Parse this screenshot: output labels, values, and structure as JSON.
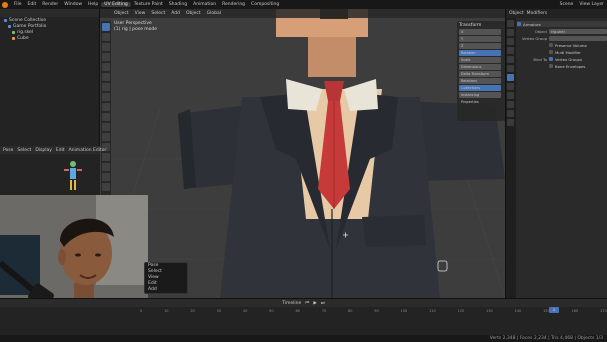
{
  "menubar": {
    "items": [
      "File",
      "Edit",
      "Render",
      "Window",
      "Help"
    ],
    "tabs": [
      "UV Editing",
      "Texture Paint",
      "Shading",
      "Animation",
      "Rendering",
      "Compositing"
    ],
    "active_tab": "UV Editing",
    "right": [
      "Scene",
      "View Layer"
    ]
  },
  "outliner": {
    "items": [
      "Scene Collection",
      "Game Portfolio",
      "rig.skel",
      "Cube"
    ]
  },
  "viewport": {
    "header": [
      "User Perspective",
      "Object",
      "View",
      "Select",
      "Add",
      "Object",
      "Global"
    ],
    "info": [
      "User Perspective",
      "(1) rig | pose mode"
    ]
  },
  "npanel": {
    "section": "Transform",
    "rows": [
      "X",
      "Y",
      "Z",
      "Rotation",
      "Scale",
      "Dimensions",
      "Delta Transform",
      "Relations",
      "Collections",
      "Instancing",
      "Properties"
    ],
    "tabs": [
      "Item",
      "Tool",
      "View"
    ]
  },
  "rig_panel": {
    "tabs": [
      "Pose",
      "Select",
      "Display",
      "Edit"
    ],
    "title": "Animation Editor"
  },
  "context_menu": {
    "items": [
      "Pose",
      "Select",
      "View",
      "Edit",
      "Add"
    ]
  },
  "properties": {
    "header": [
      "Object",
      "Modifiers"
    ],
    "title": "Armature",
    "rows": [
      {
        "label": "Object",
        "value": "rig.skel"
      },
      {
        "label": "Vertex Group",
        "value": ""
      },
      {
        "label": "",
        "value": "Preserve Volume"
      },
      {
        "label": "",
        "value": "Multi Modifier"
      },
      {
        "label": "Bind To",
        "value": "Vertex Groups"
      },
      {
        "label": "",
        "value": "Bone Envelopes"
      }
    ]
  },
  "timeline": {
    "title": "Timeline",
    "frame": "1",
    "ticks": [
      "0",
      "10",
      "20",
      "30",
      "40",
      "50",
      "60",
      "70",
      "80",
      "90",
      "100",
      "110",
      "120",
      "130",
      "140",
      "150",
      "160",
      "170"
    ]
  },
  "statusbar": {
    "text": "Verts 2,348 | Faces 2,234 | Tris 4,468 | Objects 1/3"
  },
  "colors": {
    "accent": "#4772b3",
    "tie": "#c73a3a",
    "suit": "#2f3238",
    "skin": "#e8b98f"
  }
}
